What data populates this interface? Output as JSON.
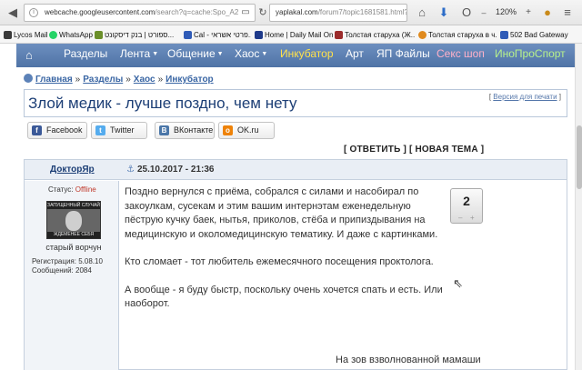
{
  "browser": {
    "url_left_host": "webcache.googleusercontent.com",
    "url_left_rest": "/search?q=cache:Spo_A2",
    "url_right_host": "yaplakal.com",
    "url_right_rest": "/forum7/topic1681581.html?hl=",
    "zoom": "120%",
    "icons": [
      "back-icon",
      "info-icon",
      "reader-icon",
      "reload-icon",
      "home-icon",
      "download-icon",
      "opera-icon",
      "menu-icon",
      "avatar-icon"
    ]
  },
  "bookmarks": [
    {
      "label": "Lycos Mail",
      "color": "#3a3a3a"
    },
    {
      "label": "WhatsApp",
      "color": "#25d366"
    },
    {
      "label": "ספורט | בנק דיסקונט...",
      "color": "#6b8f2a"
    },
    {
      "label": "Cal - פרטי אשראי...",
      "color": "#2f5bb7"
    },
    {
      "label": "Home | Daily Mail Online",
      "color": "#1e3a8a"
    },
    {
      "label": "Толстая старуха (Ж...",
      "color": "#9b2b2b"
    },
    {
      "label": "Толстая старуха в ч...",
      "color": "#e08a1e"
    },
    {
      "label": "502 Bad Gateway",
      "color": "#2f5bb7"
    }
  ],
  "nav": {
    "items": [
      {
        "label": "Разделы",
        "caret": false,
        "color": "white"
      },
      {
        "label": "Лента",
        "caret": true,
        "color": "white"
      },
      {
        "label": "Общение",
        "caret": true,
        "color": "white"
      },
      {
        "label": "Хаос",
        "caret": true,
        "color": "white"
      },
      {
        "label": "Инкубатор",
        "caret": false,
        "color": "yellow"
      },
      {
        "label": "Арт",
        "caret": false,
        "color": "white"
      },
      {
        "label": "ЯП Файлы",
        "caret": false,
        "color": "white"
      },
      {
        "label": "Секс шоп",
        "caret": false,
        "color": "pink"
      },
      {
        "label": "ИноПроСпорт",
        "caret": false,
        "color": "green"
      }
    ]
  },
  "breadcrumb": [
    "Главная",
    "Разделы",
    "Хаос",
    "Инкубатор"
  ],
  "breadcrumb_sep": "»",
  "topic": {
    "title": "Злой медик - лучше поздно, чем нету",
    "print_link": "Версия для печати"
  },
  "share": [
    {
      "label": "Facebook",
      "icon": "facebook-icon",
      "color": "#3b5998",
      "glyph": "f"
    },
    {
      "label": "Twitter",
      "icon": "twitter-icon",
      "color": "#55acee",
      "glyph": "t"
    },
    {
      "label": "ВКонтакте",
      "icon": "vk-icon",
      "color": "#4a76a8",
      "glyph": "B"
    },
    {
      "label": "OK.ru",
      "icon": "ok-icon",
      "color": "#ee8208",
      "glyph": "o"
    }
  ],
  "reply_links": {
    "reply": "ОТВЕТИТЬ",
    "new_topic": "НОВАЯ ТЕМА"
  },
  "post": {
    "author": "ДокторЯр",
    "date": "25.10.2017 - 21:36",
    "status_label": "Статус:",
    "status_value": "Offline",
    "avatar_caption_top": "ЗАПУЩЕННЫЙ СЛУЧАЙ",
    "avatar_caption_bottom": "ЖДЕМЕНЕЕ СЕБЯ",
    "user_title": "старый ворчун",
    "registration": "Регистрация: 5.08.10",
    "messages": "Сообщений: 2084",
    "paragraphs": [
      "Поздно вернулся с приёма, собрался с силами и насобирал по закоулкам, сусекам и этим вашим интернэтам еженедельную пёструю кучку баек, нытья, приколов, стёба и припиздывания на медицинскую и околомедицинскую тематику. И даже с картинками.",
      "Кто сломает - тот любитель ежемесячного посещения проктолога.",
      "А вообще - я буду быстр, поскольку очень хочется спать и есть. Или наоборот."
    ],
    "signature": "На зов взволнованной мамаши",
    "rating": "2",
    "rating_minus": "–",
    "rating_plus": "+"
  }
}
